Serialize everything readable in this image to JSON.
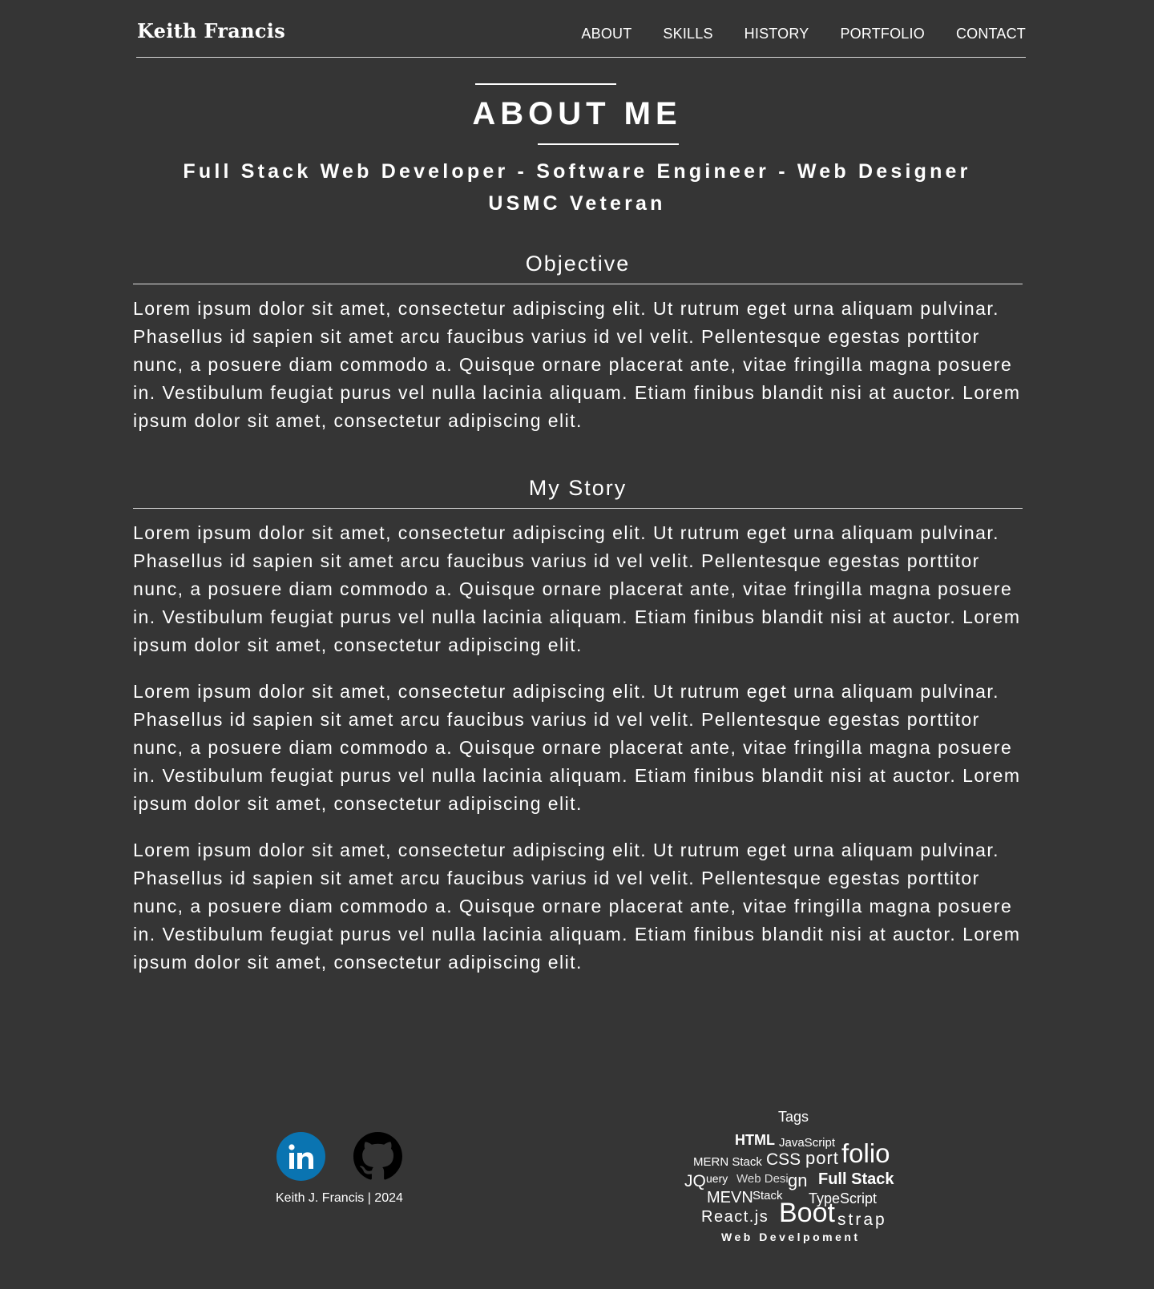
{
  "header": {
    "brand": "Keith Francis",
    "nav": [
      "ABOUT",
      "SKILLS",
      "HISTORY",
      "PORTFOLIO",
      "CONTACT"
    ]
  },
  "hero": {
    "title": "ABOUT ME",
    "tagline_line1": "Full Stack Web Developer - Software Engineer - Web Designer",
    "tagline_line2": "USMC Veteran"
  },
  "objective": {
    "heading": "Objective",
    "text": "Lorem ipsum dolor sit amet, consectetur adipiscing elit. Ut rutrum eget urna aliquam pulvinar. Phasellus id sapien sit amet arcu faucibus varius id vel velit. Pellentesque egestas porttitor nunc, a posuere diam commodo a. Quisque ornare placerat ante, vitae fringilla magna posuere in. Vestibulum feugiat purus vel nulla lacinia aliquam. Etiam finibus blandit nisi at auctor. Lorem ipsum dolor sit amet, consectetur adipiscing elit."
  },
  "story": {
    "heading": "My Story",
    "paragraphs": [
      "Lorem ipsum dolor sit amet, consectetur adipiscing elit. Ut rutrum eget urna aliquam pulvinar. Phasellus id sapien sit amet arcu faucibus varius id vel velit. Pellentesque egestas porttitor nunc, a posuere diam commodo a. Quisque ornare placerat ante, vitae fringilla magna posuere in. Vestibulum feugiat purus vel nulla lacinia aliquam. Etiam finibus blandit nisi at auctor. Lorem ipsum dolor sit amet, consectetur adipiscing elit.",
      "Lorem ipsum dolor sit amet, consectetur adipiscing elit. Ut rutrum eget urna aliquam pulvinar. Phasellus id sapien sit amet arcu faucibus varius id vel velit. Pellentesque egestas porttitor nunc, a posuere diam commodo a. Quisque ornare placerat ante, vitae fringilla magna posuere in. Vestibulum feugiat purus vel nulla lacinia aliquam. Etiam finibus blandit nisi at auctor. Lorem ipsum dolor sit amet, consectetur adipiscing elit.",
      "Lorem ipsum dolor sit amet, consectetur adipiscing elit. Ut rutrum eget urna aliquam pulvinar. Phasellus id sapien sit amet arcu faucibus varius id vel velit. Pellentesque egestas porttitor nunc, a posuere diam commodo a. Quisque ornare placerat ante, vitae fringilla magna posuere in. Vestibulum feugiat purus vel nulla lacinia aliquam. Etiam finibus blandit nisi at auctor. Lorem ipsum dolor sit amet, consectetur adipiscing elit."
    ]
  },
  "footer": {
    "social": [
      {
        "name": "linkedin-icon",
        "color": "#0a74b1"
      },
      {
        "name": "github-icon",
        "color": "#000000"
      }
    ],
    "copyright": "Keith J. Francis | 2024",
    "tags_title": "Tags",
    "tags": {
      "html": "HTML",
      "javascript": "JavaScript",
      "port": "port",
      "folio": "folio",
      "mern": "MERN Stack",
      "css": "CSS",
      "jq": "JQ",
      "uery": "uery",
      "webdesi": "Web Desi",
      "gn": "gn",
      "fullstack": "Full Stack",
      "mevn": "MEVN",
      "stack": "Stack",
      "typescript": "TypeScript",
      "react": "React.js",
      "boot": "Boot",
      "strap": "strap",
      "webdev": "Web Develpoment"
    }
  },
  "colors": {
    "background": "#353535",
    "text": "#ffffff",
    "linkedin": "#0a74b1"
  }
}
